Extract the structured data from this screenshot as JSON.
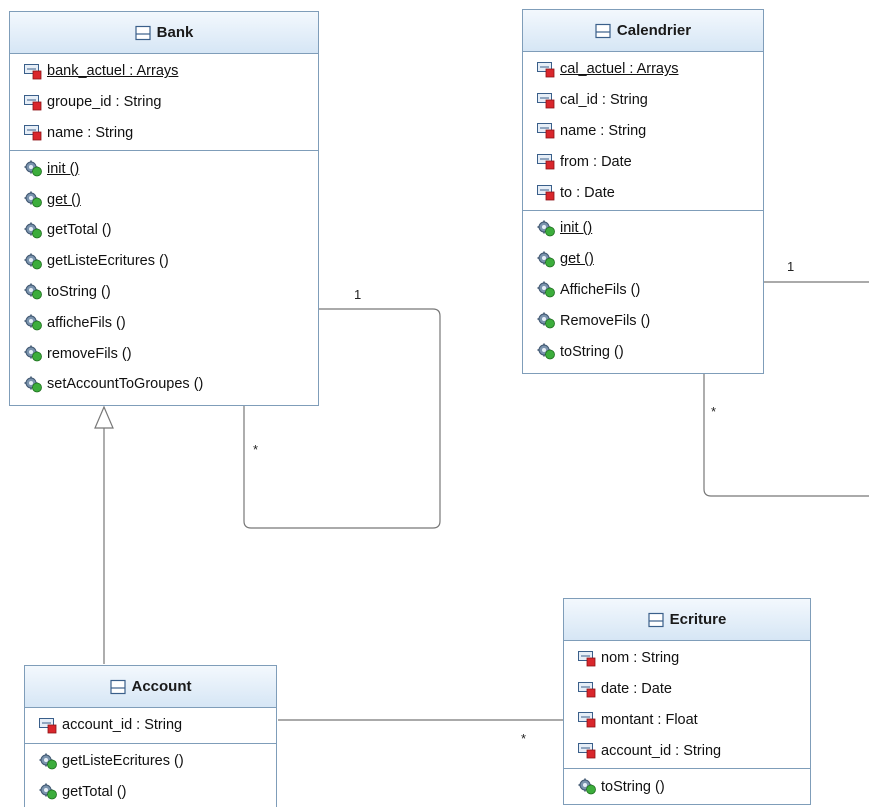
{
  "colors": {
    "border": "#7f9db9",
    "header_top": "#f3f8fd",
    "header_bottom": "#d6e6f5",
    "line": "#777777"
  },
  "icons": {
    "class": "class-icon",
    "attribute": "field-icon",
    "operation": "method-gear-icon"
  },
  "classes": {
    "bank": {
      "name": "Bank",
      "attributes": [
        "bank_actuel : Arrays",
        "groupe_id : String",
        "name : String"
      ],
      "operations": [
        "init ()",
        "get ()",
        "getTotal ()",
        "getListeEcritures ()",
        "toString ()",
        "afficheFils ()",
        "removeFils ()",
        "setAccountToGroupes ()"
      ]
    },
    "calendrier": {
      "name": "Calendrier",
      "attributes": [
        "cal_actuel : Arrays",
        "cal_id : String",
        "name : String",
        "from : Date",
        "to : Date"
      ],
      "operations": [
        "init ()",
        "get ()",
        "AfficheFils ()",
        "RemoveFils ()",
        "toString ()"
      ]
    },
    "account": {
      "name": "Account",
      "attributes": [
        "account_id : String"
      ],
      "operations": [
        "getListeEcritures ()",
        "getTotal ()"
      ]
    },
    "ecriture": {
      "name": "Ecriture",
      "attributes": [
        "nom : String",
        "date : Date",
        "montant : Float",
        "account_id : String"
      ],
      "operations": [
        "toString ()"
      ]
    }
  },
  "multiplicities": {
    "bank_self_one": "1",
    "bank_self_many": "*",
    "cal_self_one": "1",
    "cal_self_many": "*",
    "account_ecriture_many": "*"
  }
}
